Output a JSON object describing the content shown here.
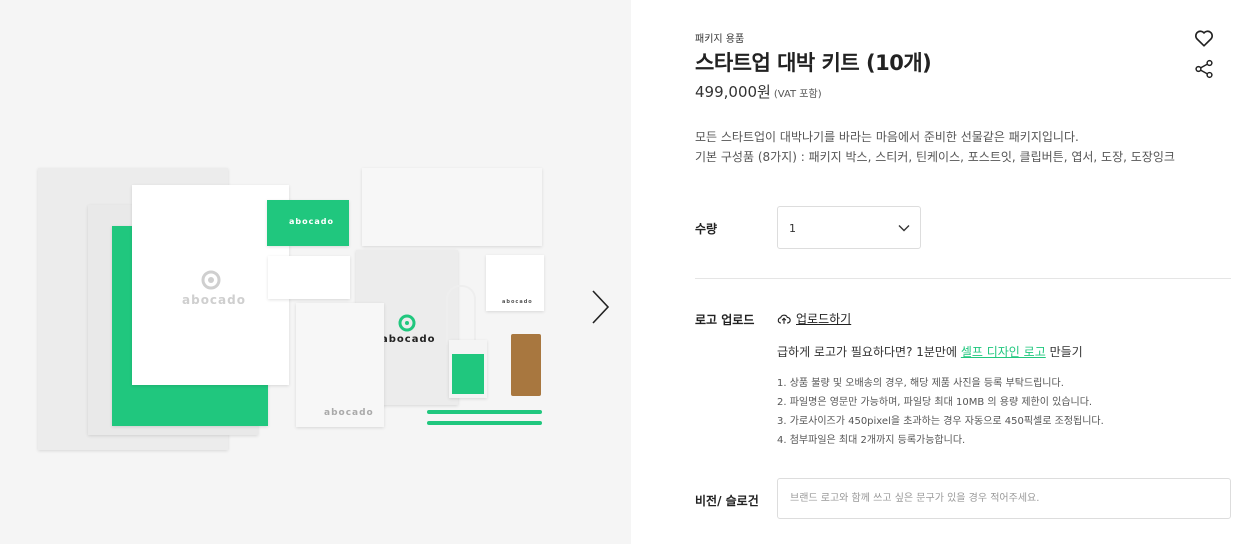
{
  "gallery": {
    "brand_name": "abocado",
    "next_icon": "chevron-right-icon"
  },
  "product": {
    "category": "패키지 용품",
    "title": "스타트업 대박 키트 (10개)",
    "price": "499,000원",
    "vat_note": "(VAT 포함)",
    "description": [
      "모든 스타트업이 대박나기를 바라는 마음에서 준비한 선물같은 패키지입니다.",
      "기본 구성품 (8가지) : 패키지 박스, 스티커, 틴케이스, 포스트잇, 클립버튼, 엽서, 도장, 도장잉크"
    ]
  },
  "actions": {
    "wishlist_icon": "heart-icon",
    "share_icon": "share-icon"
  },
  "quantity": {
    "label": "수량",
    "value": "1"
  },
  "logo_upload": {
    "label": "로고 업로드",
    "upload_button": "업로드하기",
    "quick_prefix": "급하게 로고가 필요하다면? 1분만에 ",
    "quick_link": "셀프 디자인 로고",
    "quick_suffix": " 만들기",
    "notes": [
      "1. 상품 불량 및 오배송의 경우, 해당 제품 사진을 등록 부탁드립니다.",
      "2. 파일명은 영문만 가능하며, 파일당 최대 10MB 의 용량 제한이 있습니다.",
      "3. 가로사이즈가 450pixel을 초과하는 경우 자동으로 450픽셀로 조정됩니다.",
      "4. 첨부파일은 최대 2개까지 등록가능합니다."
    ]
  },
  "vision": {
    "label": "비전/ 슬로건",
    "placeholder": "브랜드 로고와 함께 쓰고 싶은 문구가 있을 경우 적어주세요."
  },
  "colors": {
    "accent": "#20c77e"
  }
}
